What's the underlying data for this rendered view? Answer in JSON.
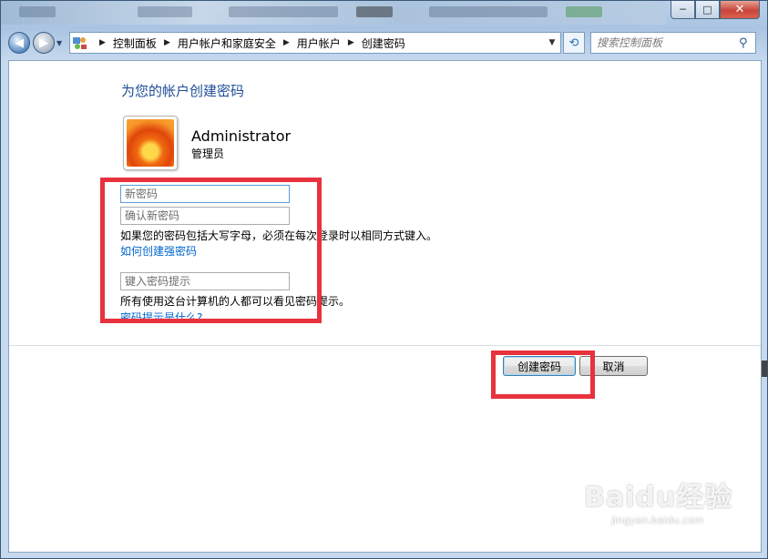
{
  "window": {
    "caption_min": "─",
    "caption_max": "□",
    "caption_close": "✕"
  },
  "nav": {
    "back_icon": "back-arrow-icon",
    "forward_icon": "forward-arrow-icon",
    "breadcrumb": [
      "控制面板",
      "用户帐户和家庭安全",
      "用户帐户",
      "创建密码"
    ],
    "search_placeholder": "搜索控制面板"
  },
  "page": {
    "heading": "为您的帐户创建密码",
    "user_name": "Administrator",
    "user_role": "管理员",
    "new_password_placeholder": "新密码",
    "confirm_password_placeholder": "确认新密码",
    "case_note": "如果您的密码包括大写字母，必须在每次登录时以相同方式键入。",
    "strong_password_link": "如何创建强密码",
    "hint_placeholder": "键入密码提示",
    "hint_note": "所有使用这台计算机的人都可以看见密码提示。",
    "hint_link": "密码提示是什么?"
  },
  "buttons": {
    "create_label": "创建密码",
    "cancel_label": "取消"
  },
  "watermark": {
    "brand": "Baidu经验",
    "url": "jingyan.baidu.com"
  },
  "colors": {
    "heading": "#1e4d95",
    "link": "#0066cc",
    "annotation": "#e8323d"
  }
}
